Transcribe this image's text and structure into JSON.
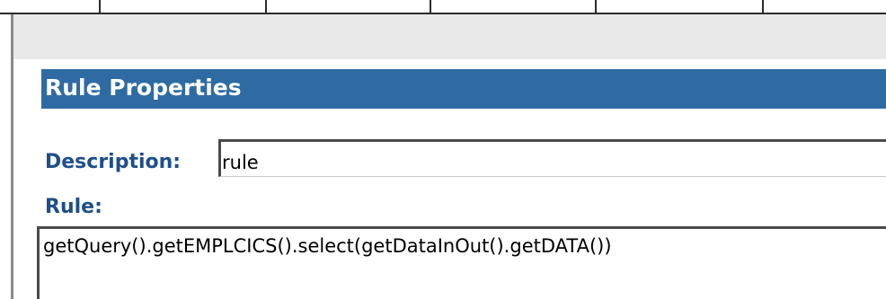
{
  "panel": {
    "title": "Rule Properties"
  },
  "form": {
    "description_label": "Description:",
    "description_value": "rule",
    "rule_label": "Rule:",
    "rule_value": "getQuery().getEMPLCICS().select(getDataInOut().getDATA())"
  },
  "colors": {
    "header_bg": "#2f6ba3",
    "label_text": "#1f4f8a",
    "band_bg": "#e9e9e9"
  }
}
